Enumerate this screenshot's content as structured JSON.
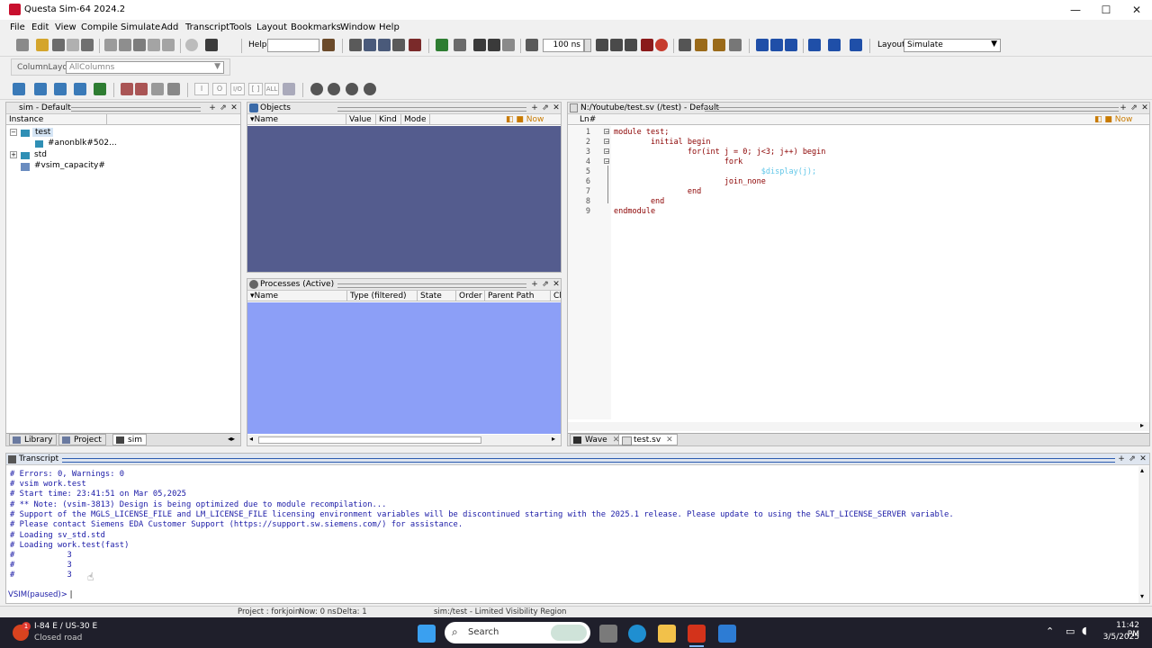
{
  "window": {
    "title": "Questa Sim-64 2024.2",
    "minimize": "—",
    "maximize": "☐",
    "close": "✕"
  },
  "menu": [
    "File",
    "Edit",
    "View",
    "Compile",
    "Simulate",
    "Add",
    "Transcript",
    "Tools",
    "Layout",
    "Bookmarks",
    "Window",
    "Help"
  ],
  "toolbar": {
    "help_label": "Help",
    "help_value": "",
    "time_value": "100",
    "time_unit": "ns",
    "layout_label": "Layout",
    "layout_value": "Simulate",
    "column_layout_label": "ColumnLayout",
    "column_layout_value": "AllColumns",
    "btn_labels": [
      "I",
      "O",
      "I/O",
      "[ ]",
      "ALL"
    ]
  },
  "sim_panel": {
    "title": "sim - Default",
    "col_instance": "Instance",
    "tree": [
      {
        "label": "test",
        "level": 0,
        "selected": true,
        "expander": "−"
      },
      {
        "label": "#anonblk#502...",
        "level": 2,
        "selected": false,
        "expander": ""
      },
      {
        "label": "std",
        "level": 0,
        "selected": false,
        "expander": "+"
      },
      {
        "label": "#vsim_capacity#",
        "level": 0,
        "selected": false,
        "expander": ""
      }
    ],
    "tabs": [
      "Library",
      "Project",
      "sim"
    ]
  },
  "objects_panel": {
    "title": "Objects",
    "columns": [
      "Name",
      "Value",
      "Kind",
      "Mode"
    ],
    "now_label": "Now",
    "bg": "#545c8e"
  },
  "processes_panel": {
    "title": "Processes (Active)",
    "columns": [
      "Name",
      "Type (filtered)",
      "State",
      "Order",
      "Parent Path",
      "Cla"
    ],
    "bg": "#8c9ff7"
  },
  "source_panel": {
    "title": "N:/Youtube/test.sv (/test) - Default",
    "col_ln": "Ln#",
    "now_label": "Now",
    "line_numbers": [
      "1",
      "2",
      "3",
      "4",
      "5",
      "6",
      "7",
      "8",
      "9"
    ],
    "lines": [
      "module test;",
      "        initial begin",
      "                for(int j = 0; j<3; j++) begin",
      "                        fork",
      "                                $display(j);",
      "                        join_none",
      "                end",
      "        end",
      "endmodule"
    ],
    "tabs": [
      "Wave",
      "test.sv"
    ]
  },
  "transcript": {
    "title": "Transcript",
    "lines": [
      "# Errors: 0, Warnings: 0",
      "# vsim work.test",
      "# Start time: 23:41:51 on Mar 05,2025",
      "# ** Note: (vsim-3813) Design is being optimized due to module recompilation...",
      "# Support of the MGLS_LICENSE_FILE and LM_LICENSE_FILE licensing environment variables will be discontinued starting with the 2025.1 release. Please update to using the SALT_LICENSE_SERVER variable.",
      "# Please contact Siemens EDA Customer Support (https://support.sw.siemens.com/) for assistance.",
      "# Loading sv_std.std",
      "# Loading work.test(fast)",
      "#           3",
      "#           3",
      "#           3"
    ],
    "prompt": "VSIM(paused)>"
  },
  "statusbar": {
    "project": "Project : forkjoin",
    "now": "Now: 0 ns",
    "delta": "Delta: 1",
    "region": "sim:/test - Limited Visibility Region"
  },
  "taskbar": {
    "weather_line1": "I-84 E / US-30 E",
    "weather_line2": "Closed road",
    "badge": "1",
    "search_placeholder": "Search",
    "time": "11:42 PM",
    "date": "3/5/2025"
  }
}
